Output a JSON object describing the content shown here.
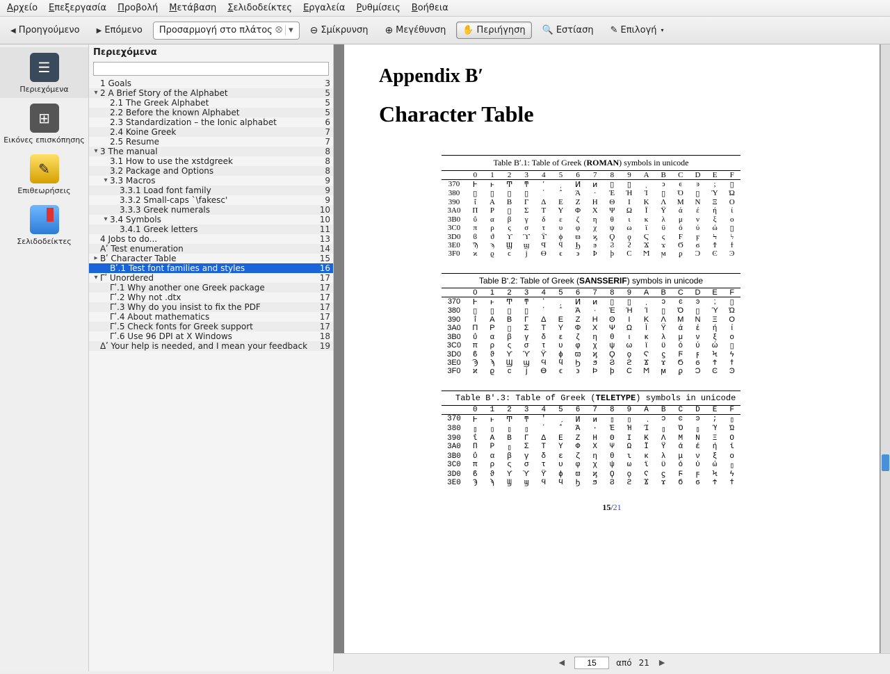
{
  "menu": [
    "Αρχείο",
    "Επεξεργασία",
    "Προβολή",
    "Μετάβαση",
    "Σελιδοδείκτες",
    "Εργαλεία",
    "Ρυθμίσεις",
    "Βοήθεια"
  ],
  "tb": {
    "prev": "Προηγούμενο",
    "next": "Επόμενο",
    "zoom_mode": "Προσαρμογή στο πλάτος",
    "zoom_out": "Σμίκρυνση",
    "zoom_in": "Μεγέθυνση",
    "browse": "Περιήγηση",
    "focus": "Εστίαση",
    "select": "Επιλογή"
  },
  "side": {
    "contents": "Περιεχόμενα",
    "thumbnails": "Εικόνες επισκόπησης",
    "reviews": "Επιθεωρήσεις",
    "bookmarks": "Σελιδοδείκτες"
  },
  "outline_title": "Περιεχόμενα",
  "toc": [
    {
      "d": 1,
      "e": "",
      "t": "1 Goals",
      "p": "3"
    },
    {
      "d": 1,
      "e": "v",
      "t": "2 A Brief Story of the Alphabet",
      "p": "5"
    },
    {
      "d": 2,
      "e": "",
      "t": "2.1 The Greek Alphabet",
      "p": "5"
    },
    {
      "d": 2,
      "e": "",
      "t": "2.2 Before the known Alphabet",
      "p": "5"
    },
    {
      "d": 2,
      "e": "",
      "t": "2.3 Standardization – the Ionic alphabet",
      "p": "6"
    },
    {
      "d": 2,
      "e": "",
      "t": "2.4 Koine Greek",
      "p": "7"
    },
    {
      "d": 2,
      "e": "",
      "t": "2.5 Resume",
      "p": "7"
    },
    {
      "d": 1,
      "e": "v",
      "t": "3 The manual",
      "p": "8"
    },
    {
      "d": 2,
      "e": "",
      "t": "3.1 How to use the xstdgreek",
      "p": "8"
    },
    {
      "d": 2,
      "e": "",
      "t": "3.2 Package and Options",
      "p": "8"
    },
    {
      "d": 2,
      "e": "v",
      "t": "3.3 Macros",
      "p": "9"
    },
    {
      "d": 3,
      "e": "",
      "t": "3.3.1 Load font family",
      "p": "9"
    },
    {
      "d": 3,
      "e": "",
      "t": "3.3.2 Small-caps `\\fakesc'",
      "p": "9"
    },
    {
      "d": 3,
      "e": "",
      "t": "3.3.3 Greek numerals",
      "p": "10"
    },
    {
      "d": 2,
      "e": "v",
      "t": "3.4 Symbols",
      "p": "10"
    },
    {
      "d": 3,
      "e": "",
      "t": "3.4.1 Greek letters",
      "p": "11"
    },
    {
      "d": 1,
      "e": "",
      "t": "4 Jobs to do...",
      "p": "13"
    },
    {
      "d": 1,
      "e": "",
      "t": "Αʹ Test enumeration",
      "p": "14"
    },
    {
      "d": 1,
      "e": ">",
      "t": "Βʹ Character Table",
      "p": "15"
    },
    {
      "d": 2,
      "e": "",
      "t": "Βʹ.1 Test font families and styles",
      "p": "16",
      "sel": true
    },
    {
      "d": 1,
      "e": "v",
      "t": "Γʹ Unordered",
      "p": "17"
    },
    {
      "d": 2,
      "e": "",
      "t": "Γʹ.1 Why another one Greek package",
      "p": "17"
    },
    {
      "d": 2,
      "e": "",
      "t": "Γʹ.2 Why not .dtx",
      "p": "17"
    },
    {
      "d": 2,
      "e": "",
      "t": "Γʹ.3 Why do you insist to fix the PDF",
      "p": "17"
    },
    {
      "d": 2,
      "e": "",
      "t": "Γʹ.4 About mathematics",
      "p": "17"
    },
    {
      "d": 2,
      "e": "",
      "t": "Γʹ.5 Check fonts for Greek support",
      "p": "17"
    },
    {
      "d": 2,
      "e": "",
      "t": "Γʹ.6 Use 96 DPI at X Windows",
      "p": "18"
    },
    {
      "d": 1,
      "e": "",
      "t": "Δʹ Your help is needed, and I mean your feedback",
      "p": "19"
    }
  ],
  "doc": {
    "h1": "Appendix Bʹ",
    "h2": "Character Table",
    "tabcap1a": "Table Bʹ.1: Table of Greek (",
    "tabcap1b": "ROMAN",
    "tabcap1c": ") symbols in unicode",
    "tabcap2a": "Table Bʹ.2: Table of Greek (",
    "tabcap2b": "SANSSERIF",
    "tabcap2c": ") symbols in unicode",
    "tabcap3a": "Table Bʹ.3: Table of Greek (",
    "tabcap3b": "TELETYPE",
    "tabcap3c": ") symbols in unicode",
    "cols": [
      "",
      "0",
      "1",
      "2",
      "3",
      "4",
      "5",
      "6",
      "7",
      "8",
      "9",
      "A",
      "B",
      "C",
      "D",
      "E",
      "F"
    ],
    "rows_labels": [
      "370",
      "380",
      "390",
      "3A0",
      "3B0",
      "3C0",
      "3D0",
      "3E0",
      "3F0"
    ],
    "rows3_labels": [
      "370",
      "380",
      "390",
      "3A0",
      "3B0",
      "3C0",
      "3D0",
      "3E0"
    ],
    "grid": [
      [
        "Ͱ",
        "ͱ",
        "Ͳ",
        "ͳ",
        "ʹ",
        "͵",
        "Ͷ",
        "ͷ",
        "▯",
        "▯",
        "ͺ",
        "ͻ",
        "ͼ",
        "ͽ",
        ";",
        "▯"
      ],
      [
        "▯",
        "▯",
        "▯",
        "▯",
        "΄",
        "΅",
        "Ά",
        "·",
        "Έ",
        "Ή",
        "Ί",
        "▯",
        "Ό",
        "▯",
        "Ύ",
        "Ώ"
      ],
      [
        "ΐ",
        "Α",
        "Β",
        "Γ",
        "Δ",
        "Ε",
        "Ζ",
        "Η",
        "Θ",
        "Ι",
        "Κ",
        "Λ",
        "Μ",
        "Ν",
        "Ξ",
        "Ο"
      ],
      [
        "Π",
        "Ρ",
        "▯",
        "Σ",
        "Τ",
        "Υ",
        "Φ",
        "Χ",
        "Ψ",
        "Ω",
        "Ϊ",
        "Ϋ",
        "ά",
        "έ",
        "ή",
        "ί"
      ],
      [
        "ΰ",
        "α",
        "β",
        "γ",
        "δ",
        "ε",
        "ζ",
        "η",
        "θ",
        "ι",
        "κ",
        "λ",
        "μ",
        "ν",
        "ξ",
        "ο"
      ],
      [
        "π",
        "ρ",
        "ς",
        "σ",
        "τ",
        "υ",
        "φ",
        "χ",
        "ψ",
        "ω",
        "ϊ",
        "ϋ",
        "ό",
        "ύ",
        "ώ",
        "▯"
      ],
      [
        "ϐ",
        "ϑ",
        "ϒ",
        "ϓ",
        "ϔ",
        "ϕ",
        "ϖ",
        "ϗ",
        "Ϙ",
        "ϙ",
        "Ϛ",
        "ϛ",
        "Ϝ",
        "ϝ",
        "Ϟ",
        "ϟ"
      ],
      [
        "Ϡ",
        "ϡ",
        "Ϣ",
        "ϣ",
        "Ϥ",
        "ϥ",
        "Ϧ",
        "ϧ",
        "Ϩ",
        "ϩ",
        "Ϫ",
        "ϫ",
        "Ϭ",
        "ϭ",
        "Ϯ",
        "ϯ"
      ],
      [
        "ϰ",
        "ϱ",
        "ϲ",
        "ϳ",
        "ϴ",
        "ϵ",
        "϶",
        "Ϸ",
        "ϸ",
        "Ϲ",
        "Ϻ",
        "ϻ",
        "ϼ",
        "Ͻ",
        "Ͼ",
        "Ͽ"
      ]
    ],
    "pagenum_cur": "15",
    "pagenum_sep": "/",
    "pagenum_tot": "21"
  },
  "status": {
    "page_input": "15",
    "of_label": "από",
    "total": "21"
  }
}
